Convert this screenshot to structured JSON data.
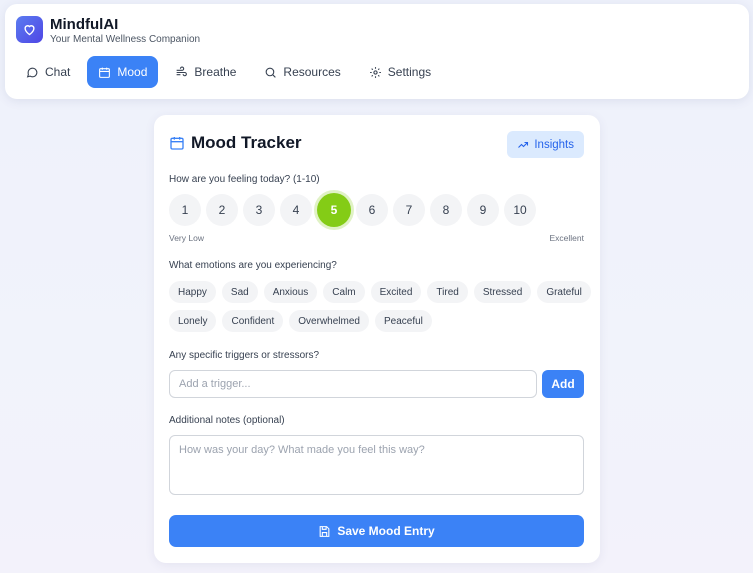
{
  "app": {
    "title": "MindfulAI",
    "subtitle": "Your Mental Wellness Companion",
    "logo_icon": "heart-icon",
    "accent": "#3b82f6"
  },
  "nav": [
    {
      "label": "Chat",
      "icon": "chat-bubble-icon",
      "active": false
    },
    {
      "label": "Mood",
      "icon": "calendar-icon",
      "active": true
    },
    {
      "label": "Breathe",
      "icon": "wind-icon",
      "active": false
    },
    {
      "label": "Resources",
      "icon": "search-icon",
      "active": false
    },
    {
      "label": "Settings",
      "icon": "gear-icon",
      "active": false
    }
  ],
  "mood": {
    "title": "Mood Tracker",
    "insights_label": "Insights",
    "rating_question": "How are you feeling today? (1-10)",
    "ratings": [
      "1",
      "2",
      "3",
      "4",
      "5",
      "6",
      "7",
      "8",
      "9",
      "10"
    ],
    "selected_rating": "5",
    "selected_color": "#84cc16",
    "scale_low": "Very Low",
    "scale_high": "Excellent",
    "emotions_question": "What emotions are you experiencing?",
    "emotions_row1": [
      "Happy",
      "Sad",
      "Anxious",
      "Calm",
      "Excited",
      "Tired",
      "Stressed",
      "Grateful"
    ],
    "emotions_row2": [
      "Lonely",
      "Confident",
      "Overwhelmed",
      "Peaceful"
    ],
    "triggers_question": "Any specific triggers or stressors?",
    "trigger_placeholder": "Add a trigger...",
    "trigger_value": "",
    "add_label": "Add",
    "notes_label": "Additional notes (optional)",
    "notes_placeholder": "How was your day? What made you feel this way?",
    "notes_value": "",
    "save_label": "Save Mood Entry"
  }
}
